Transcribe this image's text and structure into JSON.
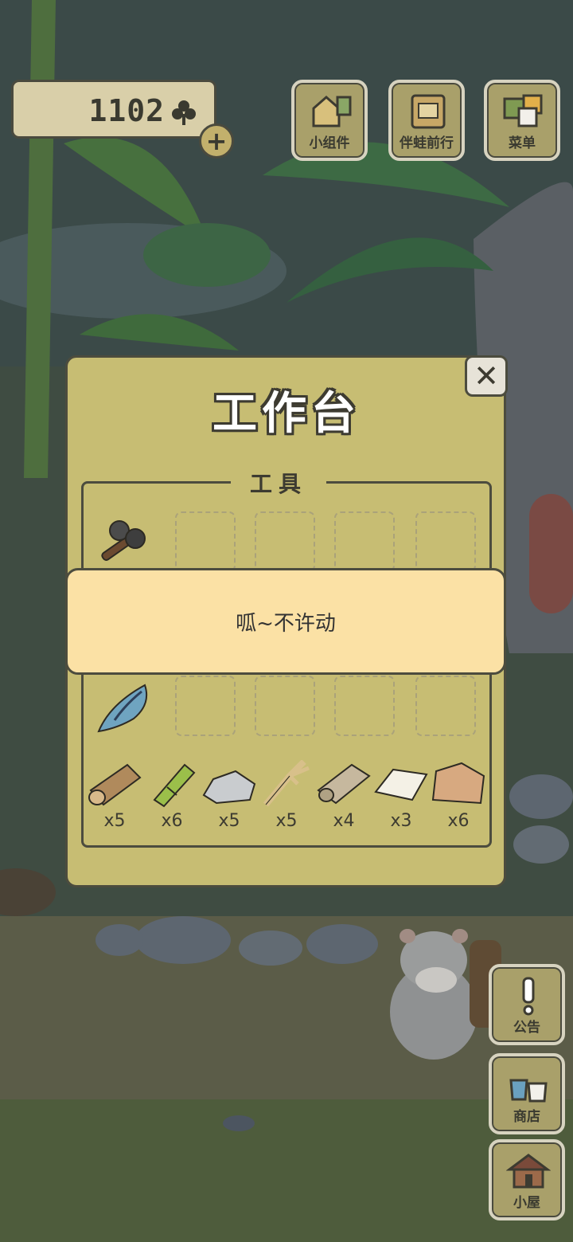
{
  "currency": {
    "amount": "1102"
  },
  "top_buttons": [
    {
      "label": "小组件",
      "icon": "widget-icon"
    },
    {
      "label": "伴蛙前行",
      "icon": "journal-icon"
    },
    {
      "label": "菜单",
      "icon": "menu-icon"
    }
  ],
  "side_buttons": [
    {
      "label": "公告",
      "icon": "exclamation-icon"
    },
    {
      "label": "商店",
      "icon": "shop-bags-icon"
    },
    {
      "label": "小屋",
      "icon": "house-icon"
    }
  ],
  "workbench": {
    "title": "工作台",
    "section_label": "工具",
    "tools": [
      {
        "icon": "stone-axe-icon"
      },
      {
        "icon": "conch-shell-icon"
      }
    ],
    "materials": [
      {
        "icon": "wood-log-icon",
        "count": "x5"
      },
      {
        "icon": "bamboo-icon",
        "count": "x6"
      },
      {
        "icon": "stone-icon",
        "count": "x5"
      },
      {
        "icon": "straw-icon",
        "count": "x5"
      },
      {
        "icon": "cloth-icon",
        "count": "x4"
      },
      {
        "icon": "paper-icon",
        "count": "x3"
      },
      {
        "icon": "clay-icon",
        "count": "x6"
      }
    ]
  },
  "toast": {
    "message": "呱~不许动"
  },
  "colors": {
    "panel": "#c7bd73",
    "toast": "#fbe1a5",
    "border": "#4c4c3e",
    "button": "#a9a06a"
  }
}
